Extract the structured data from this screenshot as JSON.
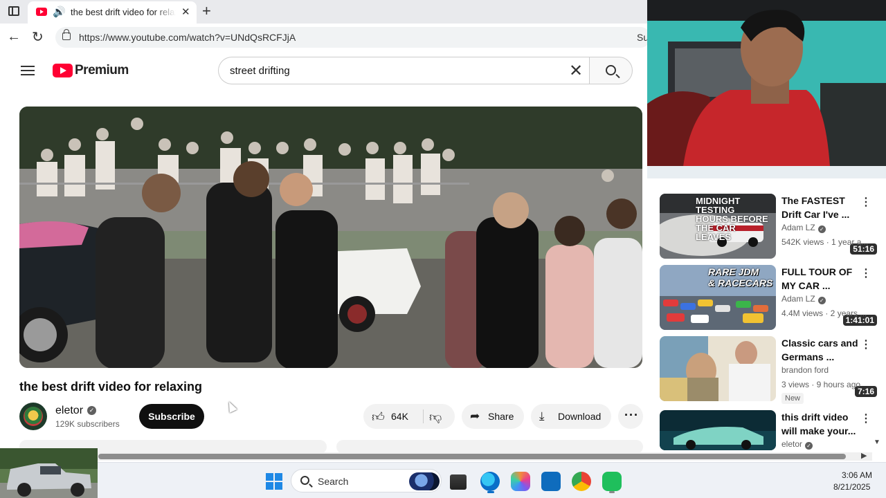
{
  "browser": {
    "tab_title": "the best drift video for relaxing",
    "url": "https://www.youtube.com/watch?v=UNdQsRCFJjA",
    "url_trail": "Su"
  },
  "youtube": {
    "brand": "Premium",
    "search_value": "street drifting",
    "brand_color": "#ff0033"
  },
  "video": {
    "title": "the best drift video for relaxing",
    "channel": "eletor",
    "subscribers": "129K subscribers",
    "subscribe_label": "Subscribe",
    "likes": "64K",
    "share_label": "Share",
    "download_label": "Download"
  },
  "related": [
    {
      "title": "The FASTEST Drift Car I've ...",
      "channel": "Adam LZ",
      "meta": "542K views · 1 year a...",
      "duration": "51:16",
      "thumb_text": "MIDNIGHT TESTING\nHOURS BEFORE THE CAR LEAVES",
      "badge": ""
    },
    {
      "title": "FULL TOUR OF MY CAR ...",
      "channel": "Adam LZ",
      "meta": "4.4M views · 2 years ...",
      "duration": "1:41:01",
      "thumb_text": "RARE JDM\n& RACECARS",
      "badge": ""
    },
    {
      "title": "Classic cars and Germans ...",
      "channel": "brandon ford",
      "meta": "3 views · 9 hours ago",
      "duration": "7:16",
      "thumb_text": "",
      "badge": "New"
    },
    {
      "title": "this drift video will make your...",
      "channel": "eletor",
      "meta": "",
      "duration": "",
      "thumb_text": "",
      "badge": ""
    }
  ],
  "taskbar": {
    "search_label": "Search",
    "time": "3:06 AM",
    "date": "8/21/2025"
  }
}
